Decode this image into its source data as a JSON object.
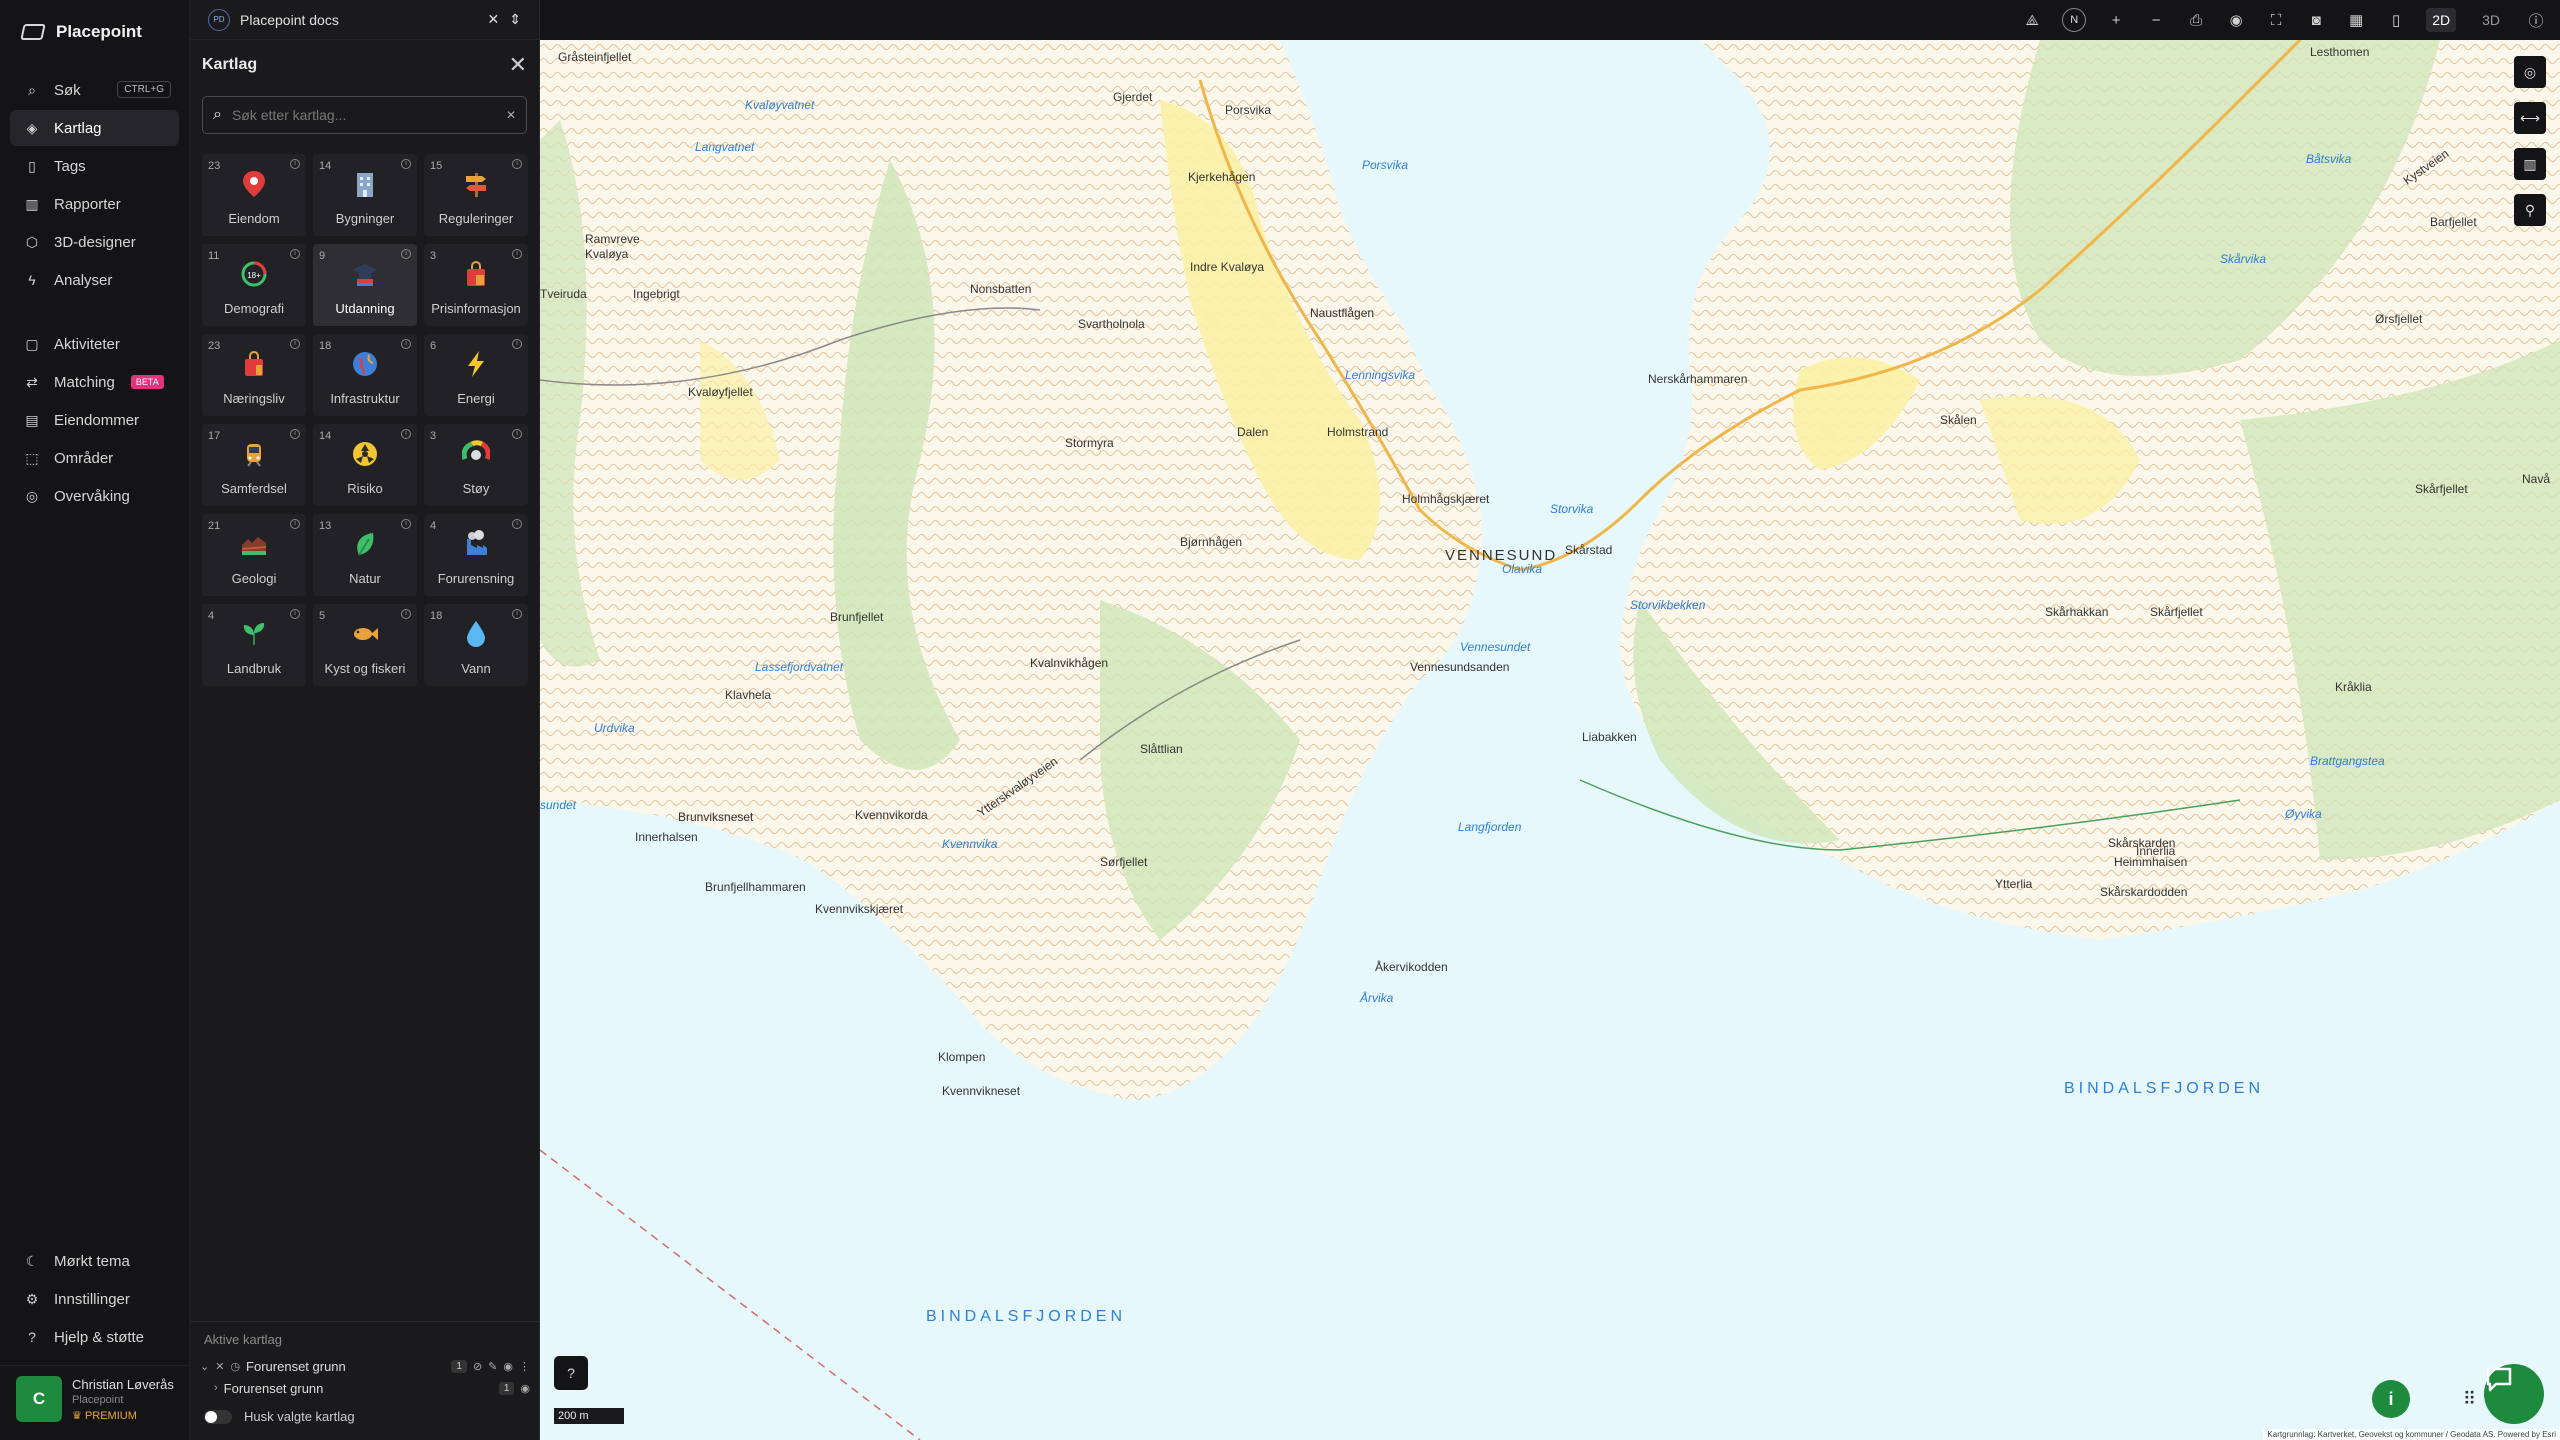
{
  "brand": "Placepoint",
  "nav": {
    "items": [
      {
        "label": "Søk",
        "icon": "search-icon",
        "shortcut": "CTRL+G"
      },
      {
        "label": "Kartlag",
        "icon": "layers-icon"
      },
      {
        "label": "Tags",
        "icon": "bookmark-icon"
      },
      {
        "label": "Rapporter",
        "icon": "bar-chart-icon"
      },
      {
        "label": "3D-designer",
        "icon": "cube-icon"
      },
      {
        "label": "Analyser",
        "icon": "lightning-icon"
      }
    ],
    "items2": [
      {
        "label": "Aktiviteter",
        "icon": "chat-icon"
      },
      {
        "label": "Matching",
        "icon": "matching-icon",
        "badge": "BETA"
      },
      {
        "label": "Eiendommer",
        "icon": "building-icon"
      },
      {
        "label": "Områder",
        "icon": "area-icon"
      },
      {
        "label": "Overvåking",
        "icon": "monitor-icon"
      }
    ],
    "bottom": [
      {
        "label": "Mørkt tema",
        "icon": "moon-icon"
      },
      {
        "label": "Innstillinger",
        "icon": "gear-icon"
      },
      {
        "label": "Hjelp & støtte",
        "icon": "help-icon"
      }
    ],
    "user": {
      "initial": "C",
      "name": "Christian Løverås",
      "org": "Placepoint",
      "plan": "PREMIUM"
    }
  },
  "doc": {
    "badge": "PD",
    "title": "Placepoint docs"
  },
  "panel": {
    "title": "Kartlag",
    "search_placeholder": "Søk etter kartlag...",
    "categories": [
      {
        "count": "23",
        "label": "Eiendom",
        "icon": "pin-icon"
      },
      {
        "count": "14",
        "label": "Bygninger",
        "icon": "building-icon"
      },
      {
        "count": "15",
        "label": "Reguleringer",
        "icon": "signpost-icon"
      },
      {
        "count": "11",
        "label": "Demografi",
        "icon": "age-icon"
      },
      {
        "count": "9",
        "label": "Utdanning",
        "icon": "graduation-icon"
      },
      {
        "count": "3",
        "label": "Prisinformasjon",
        "icon": "shopping-bag-icon"
      },
      {
        "count": "23",
        "label": "Næringsliv",
        "icon": "shop-icon"
      },
      {
        "count": "18",
        "label": "Infrastruktur",
        "icon": "globe-icon"
      },
      {
        "count": "6",
        "label": "Energi",
        "icon": "bolt-icon"
      },
      {
        "count": "17",
        "label": "Samferdsel",
        "icon": "train-icon"
      },
      {
        "count": "14",
        "label": "Risiko",
        "icon": "hazard-icon"
      },
      {
        "count": "3",
        "label": "Støy",
        "icon": "noise-gauge-icon"
      },
      {
        "count": "21",
        "label": "Geologi",
        "icon": "geology-icon"
      },
      {
        "count": "13",
        "label": "Natur",
        "icon": "leaf-icon"
      },
      {
        "count": "4",
        "label": "Forurensning",
        "icon": "factory-icon"
      },
      {
        "count": "4",
        "label": "Landbruk",
        "icon": "sprout-icon"
      },
      {
        "count": "5",
        "label": "Kyst og fiskeri",
        "icon": "fish-icon"
      },
      {
        "count": "18",
        "label": "Vann",
        "icon": "water-drop-icon"
      }
    ],
    "active_title": "Aktive kartlag",
    "active_group": {
      "label": "Forurenset grunn",
      "count": "1"
    },
    "active_child": {
      "label": "Forurenset grunn",
      "count": "1"
    },
    "remember_label": "Husk valgte kartlag"
  },
  "toolbar": {
    "north": "N",
    "mode_2d": "2D",
    "mode_3d": "3D"
  },
  "map": {
    "scale": "200 m",
    "attribution": "Kartgrunnlag: Kartverket, Geovekst og kommuner / Geodata AS. Powered by Esri",
    "places": [
      "Gråsteinfjellet",
      "Kvaløyvatnet",
      "Langvatnet",
      "Ramvreve",
      "Kvaløya",
      "Tveiruda",
      "Ingebrigt",
      "Kvaløyfjellet",
      "Nonsbatten",
      "Gjerdet",
      "Porsvika",
      "Porsvika",
      "Kjerkehågen",
      "Indre Kvaløya",
      "Svartholnola",
      "Naustflågen",
      "Lenningsvika",
      "Stormyra",
      "Dalen",
      "Holmstrand",
      "Holmhågskjæret",
      "Bjørnhågen",
      "VENNESUND",
      "Skårstad",
      "Olavika",
      "Storvika",
      "Storvikbekken",
      "Kvalnvikhågen",
      "Brunfjellet",
      "Lassefjordvatnet",
      "Klavhela",
      "Vennesundsanden",
      "Vennesundet",
      "Urdvika",
      "Slåttlian",
      "Ytterskvaløyveien",
      "sundet",
      "Brunviksneset",
      "Kvennvikorda",
      "Innerhalsen",
      "Kvennvika",
      "Sørfjellet",
      "Brunfjellhammaren",
      "Kvennvikskjæret",
      "Langfjorden",
      "Åkervikodden",
      "Årvika",
      "Klompen",
      "Kvennvikneset",
      "Lesthomen",
      "Båtsvika",
      "Kystveien",
      "Barfjellet",
      "Skårvika",
      "Nerskårhammaren",
      "Skårfjellet",
      "Skålen",
      "Skårhakkan",
      "Skårfjellet",
      "Liabakken",
      "Skårskarden",
      "Heimmhaisen",
      "Innerlia",
      "Ytterlia",
      "Skårskardodden",
      "Kråklia",
      "Brattgangstea",
      "Øyvika",
      "Navå",
      "Ørsfjellet",
      "BINDALSFJORDEN",
      "BINDALSFJORDEN"
    ]
  },
  "colors": {
    "accent": "#1e8a3e",
    "beta": "#e5327f",
    "premium": "#e9a23b",
    "water": "#e6f8fb",
    "land": "#fbf7ea"
  }
}
